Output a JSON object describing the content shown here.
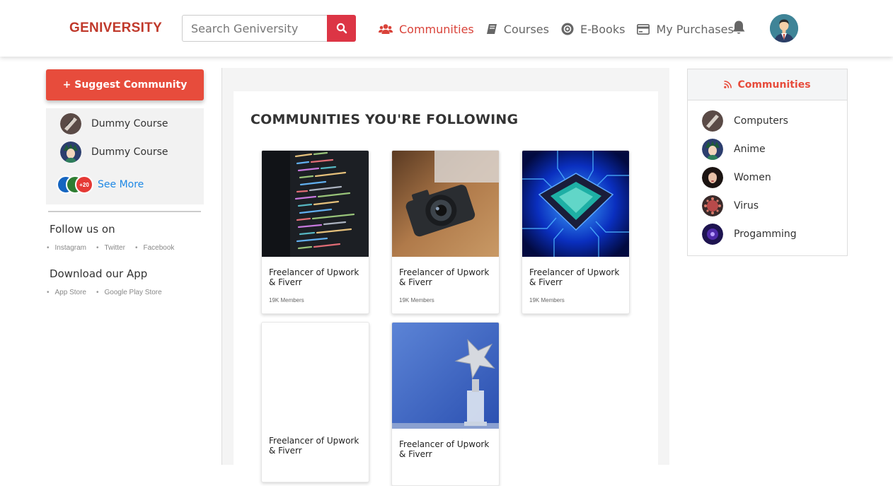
{
  "header": {
    "logo": "GENIVERSITY",
    "search_placeholder": "Search Geniversity",
    "nav": [
      {
        "label": "Communities",
        "icon": "users-icon",
        "active": true
      },
      {
        "label": "Courses",
        "icon": "book-icon",
        "active": false
      },
      {
        "label": "E-Books",
        "icon": "ebook-icon",
        "active": false
      },
      {
        "label": "My Purchases",
        "icon": "credit-card-icon",
        "active": false
      }
    ]
  },
  "left": {
    "suggest_label": "+ Suggest Community",
    "courses": [
      {
        "label": "Dummy Course"
      },
      {
        "label": "Dummy Course"
      }
    ],
    "more_count": "+20",
    "see_more": "See More",
    "follow_title": "Follow us on",
    "social_links": [
      "Instagram",
      "Twitter",
      "Facebook"
    ],
    "download_title": "Download our App",
    "app_links": [
      "App Store",
      "Google Play Store"
    ]
  },
  "main": {
    "title": "COMMUNITIES YOU'RE FOLLOWING",
    "communities": [
      {
        "name": "Freelancer of Upwork & Fiverr",
        "members": "19K Members",
        "image": "code-screen"
      },
      {
        "name": "Freelancer of Upwork & Fiverr",
        "members": "19K Members",
        "image": "camera"
      },
      {
        "name": "Freelancer of Upwork & Fiverr",
        "members": "19K Members",
        "image": "chip"
      },
      {
        "name": "Freelancer of Upwork & Fiverr",
        "members": "",
        "image": "blank"
      },
      {
        "name": "Freelancer of Upwork & Fiverr",
        "members": "",
        "image": "trophy"
      }
    ]
  },
  "right": {
    "title": "Communities",
    "items": [
      {
        "label": "Computers"
      },
      {
        "label": "Anime"
      },
      {
        "label": "Women"
      },
      {
        "label": "Virus"
      },
      {
        "label": "Progamming"
      }
    ]
  },
  "colors": {
    "brand": "#c0392b",
    "accent": "#e74c3c",
    "search_button": "#dc3545",
    "link": "#1e88e5"
  }
}
